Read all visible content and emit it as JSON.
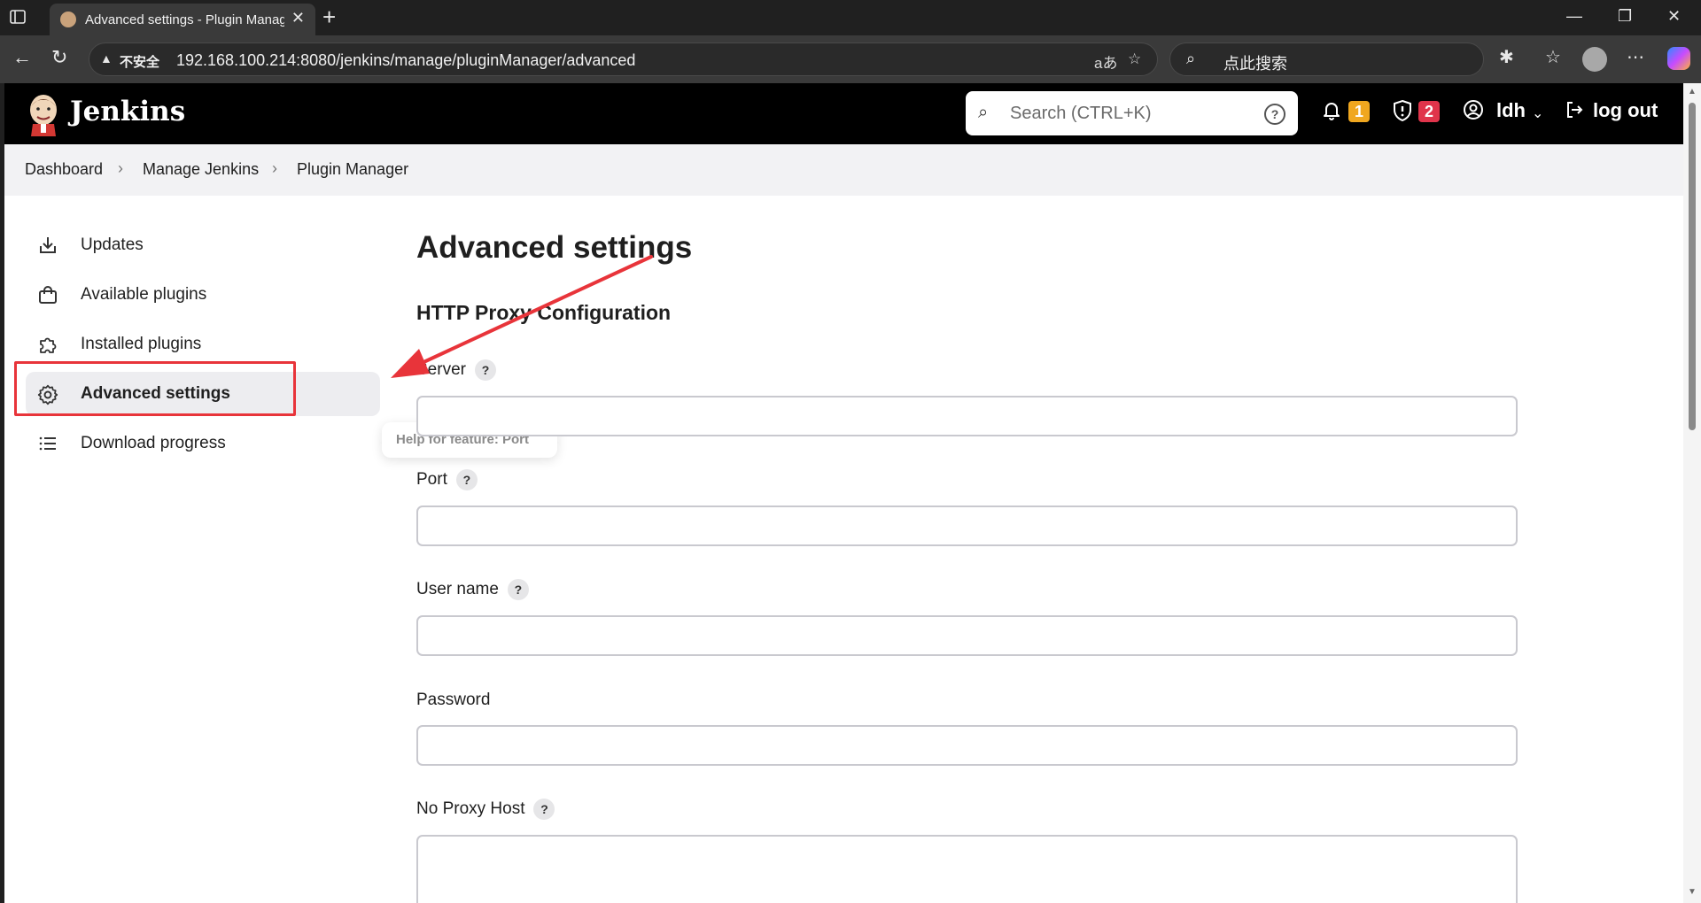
{
  "browser": {
    "tab_title": "Advanced settings - Plugin Manager",
    "insecure_label": "不安全",
    "url": "192.168.100.214:8080/jenkins/manage/pluginManager/advanced",
    "search_placeholder": "点此搜索",
    "read_aloud": "aあ"
  },
  "header": {
    "app_name": "Jenkins",
    "search_placeholder": "Search (CTRL+K)",
    "notifications_count": "1",
    "security_count": "2",
    "user": "ldh",
    "logout": "log out",
    "colors": {
      "notification_badge": "#f0a71f",
      "security_badge": "#e0344b"
    }
  },
  "breadcrumb": {
    "items": [
      "Dashboard",
      "Manage Jenkins",
      "Plugin Manager"
    ]
  },
  "sidebar": {
    "items": [
      {
        "label": "Updates",
        "icon": "download-icon"
      },
      {
        "label": "Available plugins",
        "icon": "shopping-bag-icon"
      },
      {
        "label": "Installed plugins",
        "icon": "puzzle-icon"
      },
      {
        "label": "Advanced settings",
        "icon": "gear-icon"
      },
      {
        "label": "Download progress",
        "icon": "list-icon"
      }
    ],
    "active_index": 3
  },
  "tooltip": "Help for feature: Port",
  "main": {
    "title": "Advanced settings",
    "section_title": "HTTP Proxy Configuration",
    "fields": [
      {
        "label": "Server",
        "help": "?",
        "value": ""
      },
      {
        "label": "Port",
        "help": "?",
        "value": ""
      },
      {
        "label": "User name",
        "help": "?",
        "value": ""
      },
      {
        "label": "Password",
        "value": ""
      },
      {
        "label": "No Proxy Host",
        "help": "?",
        "value": ""
      }
    ]
  }
}
